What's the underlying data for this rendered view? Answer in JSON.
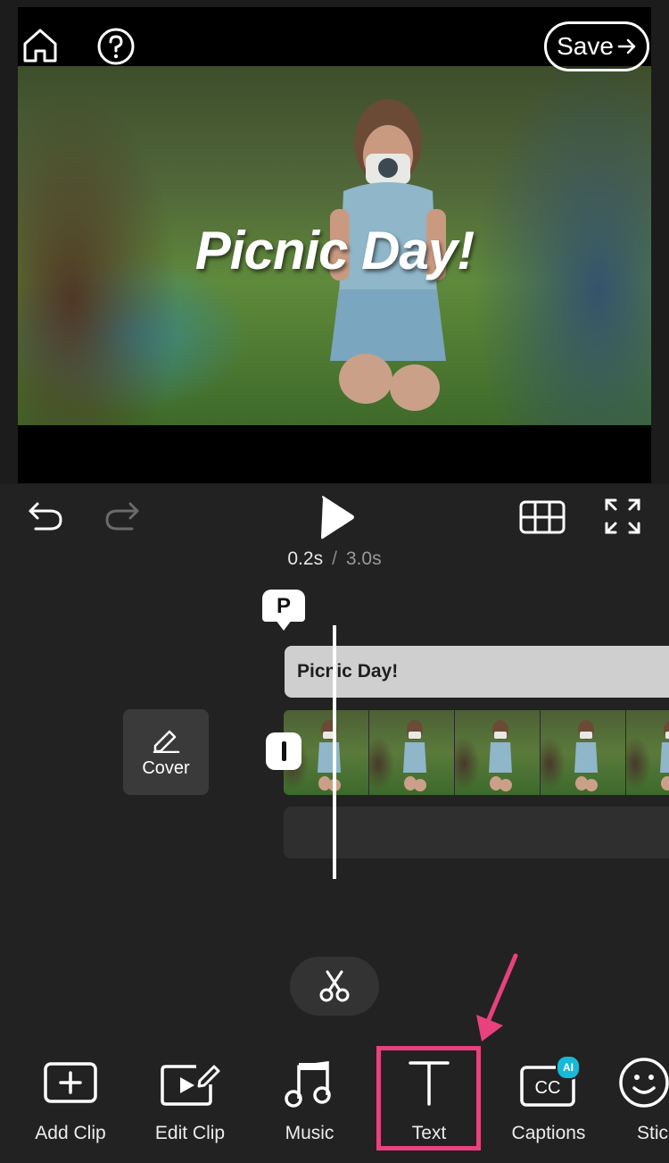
{
  "preview": {
    "overlay_title": "Picnic Day!",
    "save_label": "Save"
  },
  "controls": {
    "time_current": "0.2s",
    "time_separator": "/",
    "time_total": "3.0s"
  },
  "timeline": {
    "marker_label": "P",
    "text_track_label": "Picnic Day!",
    "cover_label": "Cover",
    "thumbnail_count": 5
  },
  "toolbar": {
    "items": [
      {
        "label": "Add Clip",
        "icon": "add-clip-icon"
      },
      {
        "label": "Edit Clip",
        "icon": "edit-clip-icon"
      },
      {
        "label": "Music",
        "icon": "music-icon"
      },
      {
        "label": "Text",
        "icon": "text-icon"
      },
      {
        "label": "Captions",
        "icon": "captions-icon",
        "badge": "AI"
      },
      {
        "label": "Stickers",
        "icon": "stickers-icon"
      }
    ],
    "captions_icon_text": "CC"
  },
  "colors": {
    "background": "#222222",
    "highlight": "#e8417e",
    "ai_badge": "#18b9d6"
  }
}
